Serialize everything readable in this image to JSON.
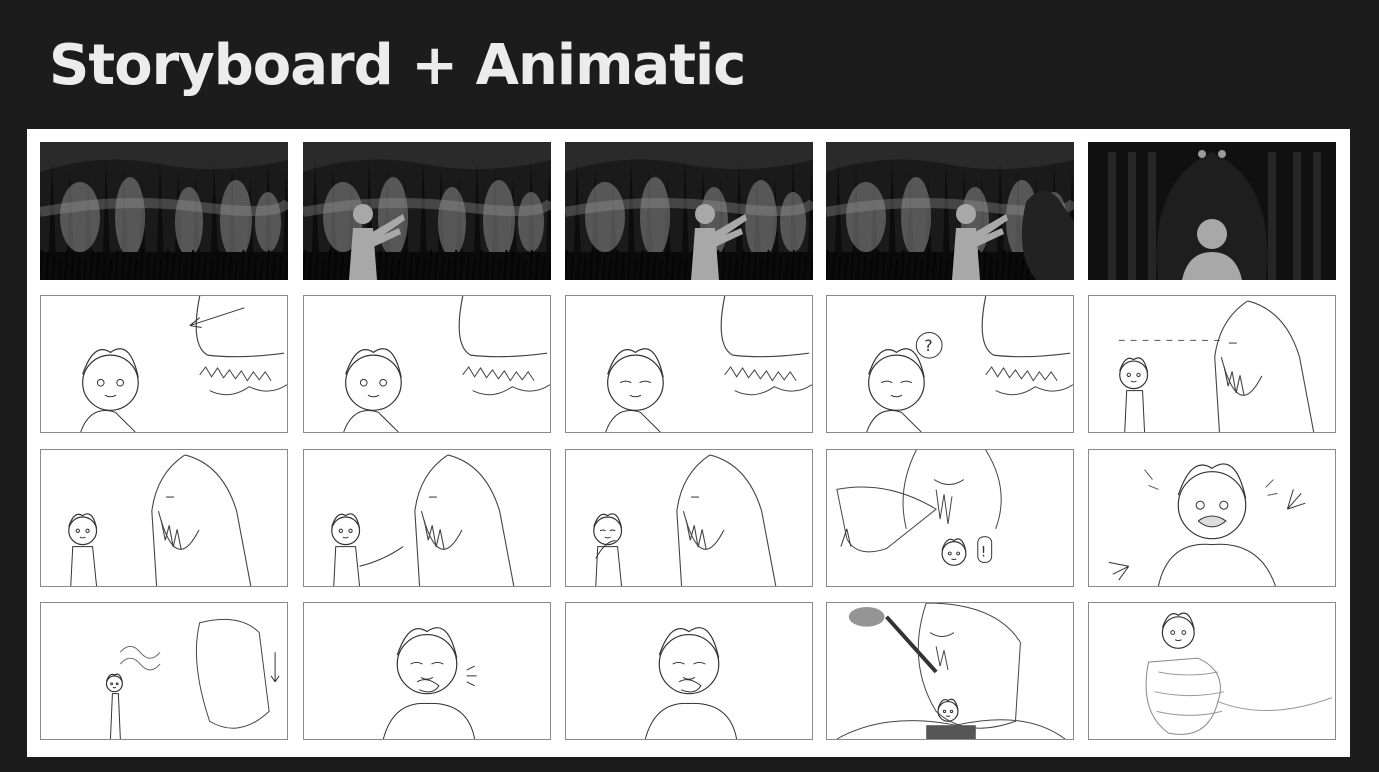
{
  "page": {
    "title": "Storyboard + Animatic"
  },
  "storyboard": {
    "rows": 4,
    "columns": 5,
    "panels": [
      {
        "id": 1,
        "tone": "dark",
        "scene": "forest-background"
      },
      {
        "id": 2,
        "tone": "dark",
        "scene": "boy-reaching-in-forest"
      },
      {
        "id": 3,
        "tone": "dark",
        "scene": "boy-reaching-in-forest"
      },
      {
        "id": 4,
        "tone": "dark",
        "scene": "giant-hand-appears"
      },
      {
        "id": 5,
        "tone": "dark",
        "scene": "boy-before-glowing-eyes"
      },
      {
        "id": 6,
        "tone": "sketch",
        "scene": "boy-and-giant-nose"
      },
      {
        "id": 7,
        "tone": "sketch",
        "scene": "boy-and-giant-nose"
      },
      {
        "id": 8,
        "tone": "sketch",
        "scene": "boy-eyes-closed-giant-nose"
      },
      {
        "id": 9,
        "tone": "sketch",
        "scene": "boy-question-mark"
      },
      {
        "id": 10,
        "tone": "sketch",
        "scene": "boy-looks-up-at-giant"
      },
      {
        "id": 11,
        "tone": "sketch",
        "scene": "boy-facing-giant"
      },
      {
        "id": 12,
        "tone": "sketch",
        "scene": "boy-gesturing-at-giant"
      },
      {
        "id": 13,
        "tone": "sketch",
        "scene": "boy-covering-mouth"
      },
      {
        "id": 14,
        "tone": "sketch",
        "scene": "giant-reaches-down"
      },
      {
        "id": 15,
        "tone": "sketch",
        "scene": "boy-frightened"
      },
      {
        "id": 16,
        "tone": "sketch",
        "scene": "giant-blowing-smoke"
      },
      {
        "id": 17,
        "tone": "sketch",
        "scene": "boy-coughing"
      },
      {
        "id": 18,
        "tone": "sketch",
        "scene": "boy-coughing-closeup"
      },
      {
        "id": 19,
        "tone": "sketch",
        "scene": "giant-with-pipe"
      },
      {
        "id": 20,
        "tone": "sketch",
        "scene": "boy-in-giant-hand"
      }
    ]
  }
}
